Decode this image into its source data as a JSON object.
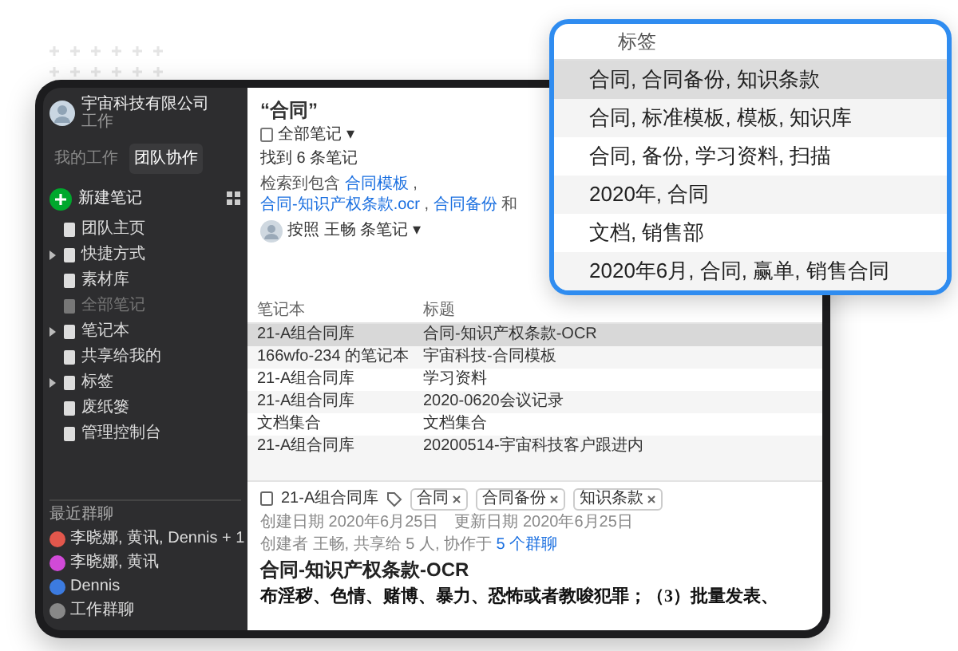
{
  "sidebar": {
    "account": {
      "name": "宇宙科技有限公司",
      "subtitle": "工作"
    },
    "tabs": [
      {
        "label": "我的工作",
        "selected": false
      },
      {
        "label": "团队协作",
        "selected": true
      }
    ],
    "new_note": "新建笔记",
    "items": [
      {
        "label": "团队主页",
        "expandable": false,
        "dimmed": false
      },
      {
        "label": "快捷方式",
        "expandable": true,
        "dimmed": false
      },
      {
        "label": "素材库",
        "expandable": false,
        "dimmed": false
      },
      {
        "label": "全部笔记",
        "expandable": false,
        "dimmed": true
      },
      {
        "label": "笔记本",
        "expandable": true,
        "dimmed": false
      },
      {
        "label": "共享给我的",
        "expandable": false,
        "dimmed": false
      },
      {
        "label": "标签",
        "expandable": true,
        "dimmed": false
      },
      {
        "label": "废纸篓",
        "expandable": false,
        "dimmed": false
      },
      {
        "label": "管理控制台",
        "expandable": false,
        "dimmed": false
      }
    ],
    "recent": {
      "heading": "最近群聊",
      "chats": [
        "李晓娜, 黄讯, Dennis + 1",
        "李晓娜, 黄讯",
        "Dennis",
        "工作群聊"
      ]
    }
  },
  "search": {
    "title": "“合同”",
    "scope": "全部笔记 ▾",
    "count": "找到 6 条笔记",
    "matches": [
      {
        "kind": "text",
        "text": "检索到包含"
      },
      {
        "kind": "link",
        "text": "合同模板"
      },
      {
        "kind": "text",
        "text": ","
      },
      {
        "kind": "link",
        "text": "合同-知识产权条款.ocr"
      },
      {
        "kind": "text",
        "text": ","
      },
      {
        "kind": "link",
        "text": "合同备份"
      },
      {
        "kind": "text",
        "text": "和"
      }
    ],
    "sort": "按照 王畅 条笔记 ▾"
  },
  "table": {
    "columns": [
      "笔记本",
      "标题"
    ],
    "rows": [
      {
        "notebook": "21-A组合同库",
        "title": "合同-知识产权条款-OCR",
        "selected": true
      },
      {
        "notebook": "166wfo-234 的笔记本",
        "title": "宇宙科技-合同模板",
        "selected": false
      },
      {
        "notebook": "21-A组合同库",
        "title": "学习资料",
        "selected": false
      },
      {
        "notebook": "21-A组合同库",
        "title": "2020-0620会议记录",
        "selected": false
      },
      {
        "notebook": "文档集合",
        "title": "文档集合",
        "selected": false
      },
      {
        "notebook": "21-A组合同库",
        "title": "20200514-宇宙科技客户跟进内",
        "selected": false
      }
    ]
  },
  "note": {
    "notebook": "21-A组合同库",
    "tags": [
      "合同",
      "合同备份",
      "知识条款"
    ],
    "created": "创建日期 2020年6月25日",
    "updated": "更新日期 2020年6月25日",
    "sharing": "创建者 王畅, 共享给 5 人, 协作于",
    "sharing_link": "5 个群聊",
    "title": "合同-知识产权条款-OCR",
    "body": "布淫秽、色情、赌博、暴力、恐怖或者教唆犯罪；（3）批量发表、"
  },
  "callout": {
    "heading": "标签",
    "rows": [
      {
        "text": "合同, 合同备份, 知识条款",
        "selected": true
      },
      {
        "text": "合同, 标准模板, 模板, 知识库",
        "selected": false
      },
      {
        "text": "合同, 备份, 学习资料, 扫描",
        "selected": false
      },
      {
        "text": "2020年, 合同",
        "selected": false
      },
      {
        "text": "文档, 销售部",
        "selected": false
      },
      {
        "text": "2020年6月, 合同, 赢单, 销售合同",
        "selected": false
      }
    ]
  }
}
